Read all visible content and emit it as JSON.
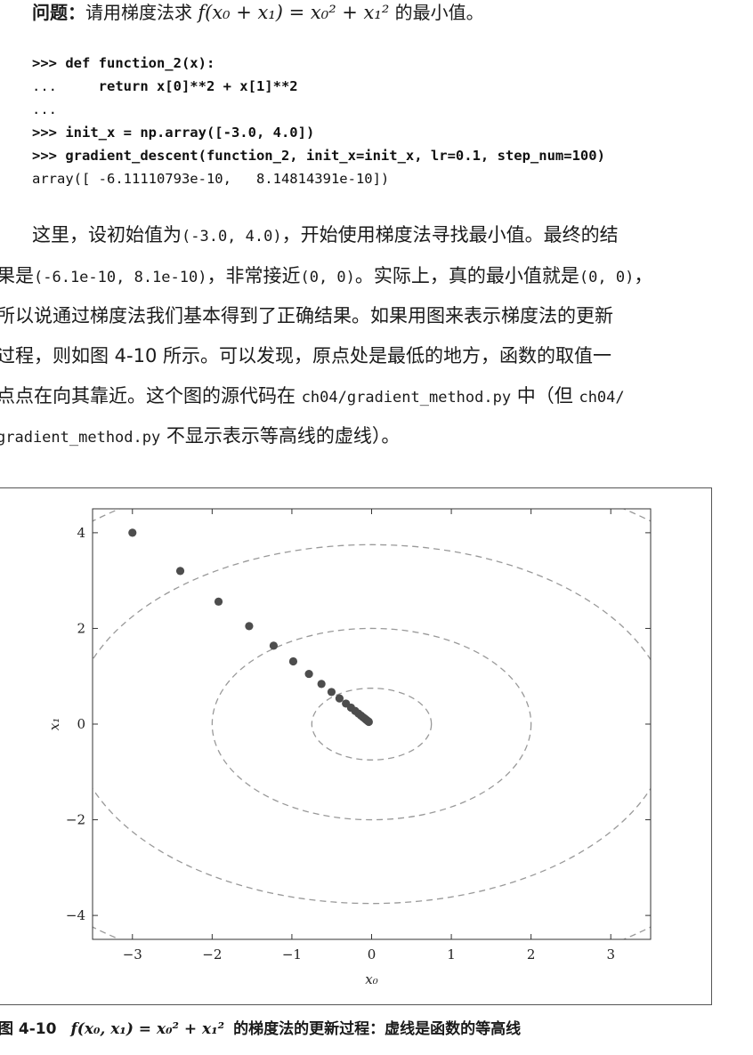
{
  "question": {
    "label": "问题：",
    "text": "请用梯度法求 ",
    "formula": "f(x₀ + x₁) = x₀² + x₁²",
    "suffix": " 的最小值。"
  },
  "code_lines": [
    [
      {
        "t": ">>> ",
        "b": true
      },
      {
        "t": "def function_2(x):",
        "b": true
      }
    ],
    [
      {
        "t": "...     ",
        "b": false
      },
      {
        "t": "return x[0]**2 + x[1]**2",
        "b": true
      }
    ],
    [
      {
        "t": "...",
        "b": false
      }
    ],
    [
      {
        "t": ">>> ",
        "b": true
      },
      {
        "t": "init_x = np.array([-3.0, 4.0])",
        "b": true
      }
    ],
    [
      {
        "t": ">>> ",
        "b": true
      },
      {
        "t": "gradient_descent(function_2, init_x=init_x, lr=0.1, step_num=100)",
        "b": true
      }
    ],
    [
      {
        "t": "array([ -6.11110793e-10,   8.14814391e-10])",
        "b": false
      }
    ]
  ],
  "paragraph_lines": [
    [
      {
        "t": "这里，设初始值为",
        "m": false
      },
      {
        "t": "(-3.0, 4.0)",
        "m": true
      },
      {
        "t": "，开始使用梯度法寻找最小值。最终的结",
        "m": false
      }
    ],
    [
      {
        "t": "果是",
        "m": false
      },
      {
        "t": "(-6.1e-10, 8.1e-10)",
        "m": true
      },
      {
        "t": "，非常接近",
        "m": false
      },
      {
        "t": "(0, 0)",
        "m": true
      },
      {
        "t": "。实际上，真的最小值就是",
        "m": false
      },
      {
        "t": "(0, 0)",
        "m": true
      },
      {
        "t": "，",
        "m": false
      }
    ],
    [
      {
        "t": "所以说通过梯度法我们基本得到了正确结果。如果用图来表示梯度法的更新",
        "m": false
      }
    ],
    [
      {
        "t": "过程，则如图 4-10 所示。可以发现，原点处是最低的地方，函数的取值一",
        "m": false
      }
    ],
    [
      {
        "t": "点点在向其靠近。这个图的源代码在 ",
        "m": false
      },
      {
        "t": "ch04/gradient_method.py",
        "m": true
      },
      {
        "t": " 中（但 ",
        "m": false
      },
      {
        "t": "ch04/",
        "m": true
      }
    ],
    [
      {
        "t": "gradient_method.py",
        "m": true
      },
      {
        "t": " 不显示表示等高线的虚线）。",
        "m": false
      }
    ]
  ],
  "chart_data": {
    "type": "scatter",
    "xlabel": "x₀",
    "ylabel": "x₁",
    "xlim": [
      -3.5,
      3.5
    ],
    "ylim": [
      -4.5,
      4.5
    ],
    "xticks": [
      -3,
      -2,
      -1,
      0,
      1,
      2,
      3
    ],
    "xtick_labels": [
      "−3",
      "−2",
      "−1",
      "0",
      "1",
      "2",
      "3"
    ],
    "yticks": [
      4,
      2,
      0,
      -2,
      -4
    ],
    "ytick_labels": [
      "4",
      "2",
      "0",
      "−2",
      "−4"
    ],
    "grid": false,
    "contours_radius": [
      0.75,
      2.0,
      3.75,
      5.5
    ],
    "contour_style": "dashed",
    "points": [
      [
        -3.0,
        4.0
      ],
      [
        -2.4,
        3.2
      ],
      [
        -1.92,
        2.56
      ],
      [
        -1.536,
        2.048
      ],
      [
        -1.229,
        1.638
      ],
      [
        -0.983,
        1.311
      ],
      [
        -0.786,
        1.049
      ],
      [
        -0.629,
        0.839
      ],
      [
        -0.503,
        0.671
      ],
      [
        -0.403,
        0.537
      ],
      [
        -0.322,
        0.429
      ],
      [
        -0.258,
        0.344
      ],
      [
        -0.206,
        0.275
      ],
      [
        -0.165,
        0.22
      ],
      [
        -0.132,
        0.176
      ],
      [
        -0.106,
        0.141
      ],
      [
        -0.084,
        0.113
      ],
      [
        -0.068,
        0.09
      ],
      [
        -0.054,
        0.072
      ],
      [
        -0.043,
        0.058
      ],
      [
        -0.035,
        0.046
      ]
    ],
    "colors": {
      "points": "#4d4d4d",
      "contours": "#999999",
      "axes": "#333333"
    }
  },
  "caption": {
    "label": "图 4-10",
    "formula": "f(x₀, x₁) = x₀² + x₁²",
    "text": "的梯度法的更新过程：虚线是函数的等高线"
  }
}
